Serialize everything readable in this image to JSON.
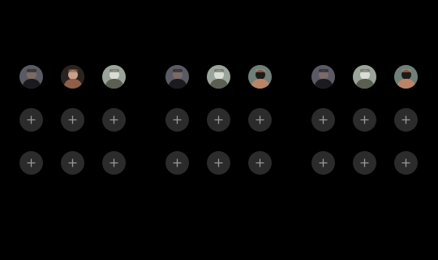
{
  "colors": {
    "background": "#000000",
    "slot_fill": "#2b2b2b",
    "plus_stroke": "#9a9a9a"
  },
  "groups": [
    {
      "avatars": [
        {
          "icon": "photo-avatar-mirror-selfie",
          "bg": "#5a5a64",
          "fg": "#1b1b1f",
          "accent": "#7b6a66"
        },
        {
          "icon": "photo-avatar-woman-dark",
          "bg": "#2a2320",
          "fg": "#8e5e48",
          "accent": "#c9a08a"
        },
        {
          "icon": "photo-avatar-outdoor",
          "bg": "#9aa49a",
          "fg": "#5b5f52",
          "accent": "#d9ddd6"
        }
      ],
      "add_slots": 6
    },
    {
      "avatars": [
        {
          "icon": "photo-avatar-mirror-selfie",
          "bg": "#5a5a64",
          "fg": "#1b1b1f",
          "accent": "#7b6a66"
        },
        {
          "icon": "photo-avatar-outdoor",
          "bg": "#9aa49a",
          "fg": "#5b5f52",
          "accent": "#d9ddd6"
        },
        {
          "icon": "photo-avatar-man-beard",
          "bg": "#6f7f7a",
          "fg": "#b98566",
          "accent": "#1f1a17"
        }
      ],
      "add_slots": 6
    },
    {
      "avatars": [
        {
          "icon": "photo-avatar-mirror-selfie",
          "bg": "#5a5a64",
          "fg": "#1b1b1f",
          "accent": "#7b6a66"
        },
        {
          "icon": "photo-avatar-outdoor",
          "bg": "#9aa49a",
          "fg": "#5b5f52",
          "accent": "#d9ddd6"
        },
        {
          "icon": "photo-avatar-man-beard",
          "bg": "#6f7f7a",
          "fg": "#b98566",
          "accent": "#1f1a17"
        }
      ],
      "add_slots": 6
    }
  ]
}
